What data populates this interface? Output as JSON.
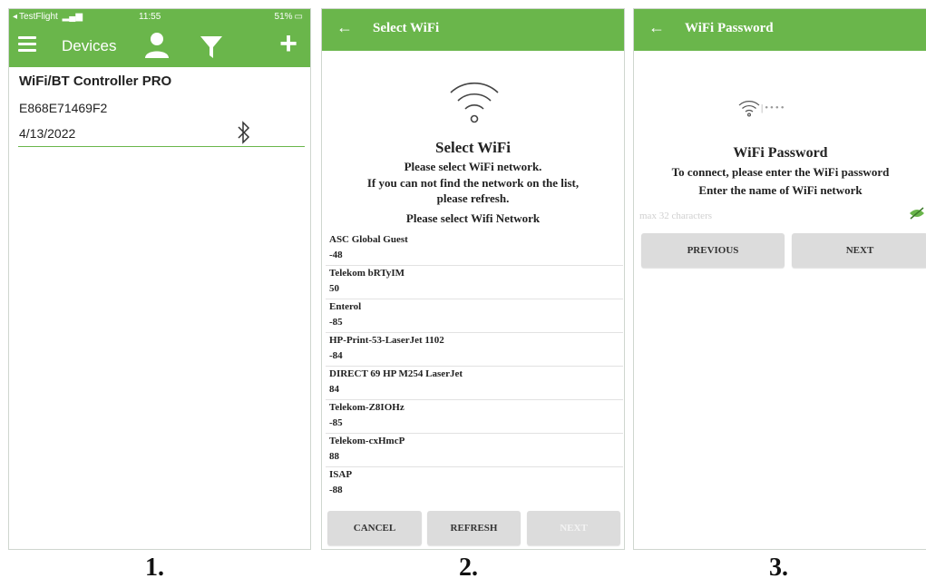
{
  "screen1": {
    "status": {
      "carrier": "TestFlight",
      "time": "11:55",
      "battery": "51%"
    },
    "appbar": {
      "title": "Devices"
    },
    "device": {
      "name": "WiFi/BT Controller PRO",
      "id": "E868E71469F2",
      "date": "4/13/2022"
    }
  },
  "screen2": {
    "appbar": {
      "title": "Select WiFi"
    },
    "heading": "Select WiFi",
    "line1": "Please select WiFi network.",
    "line2": "If you can not find the network on the list,",
    "line3": "please refresh.",
    "line4": "Please select Wifi Network",
    "networks": [
      {
        "ssid": "ASC Global Guest",
        "rssi": "-48"
      },
      {
        "ssid": "Telekom bRTyIM",
        "rssi": "50"
      },
      {
        "ssid": "Enterol",
        "rssi": "-85"
      },
      {
        "ssid": "HP-Print-53-LaserJet 1102",
        "rssi": "-84"
      },
      {
        "ssid": "DIRECT 69 HP M254 LaserJet",
        "rssi": "84"
      },
      {
        "ssid": "Telekom-Z8IOHz",
        "rssi": "-85"
      },
      {
        "ssid": "Telekom-cxHmcP",
        "rssi": "88"
      },
      {
        "ssid": "ISAP",
        "rssi": "-88"
      }
    ],
    "buttons": {
      "cancel": "CANCEL",
      "refresh": "REFRESH",
      "next": "NEXT"
    }
  },
  "screen3": {
    "appbar": {
      "title": "WiFi Password"
    },
    "password_dots": "|••••",
    "heading": "WiFi Password",
    "line1": "To connect, please enter the WiFi password",
    "line2": "Enter the name of WiFi network",
    "input_placeholder": "max 32 characters",
    "buttons": {
      "previous": "PREVIOUS",
      "next": "NEXT"
    }
  },
  "captions": [
    "1.",
    "2.",
    "3."
  ],
  "colors": {
    "brand_green": "#6ab64b"
  },
  "icons": [
    "menu-icon",
    "person-icon",
    "filter-icon",
    "plus-icon",
    "bluetooth-icon",
    "back-arrow-icon",
    "wifi-icon",
    "eye-icon"
  ]
}
